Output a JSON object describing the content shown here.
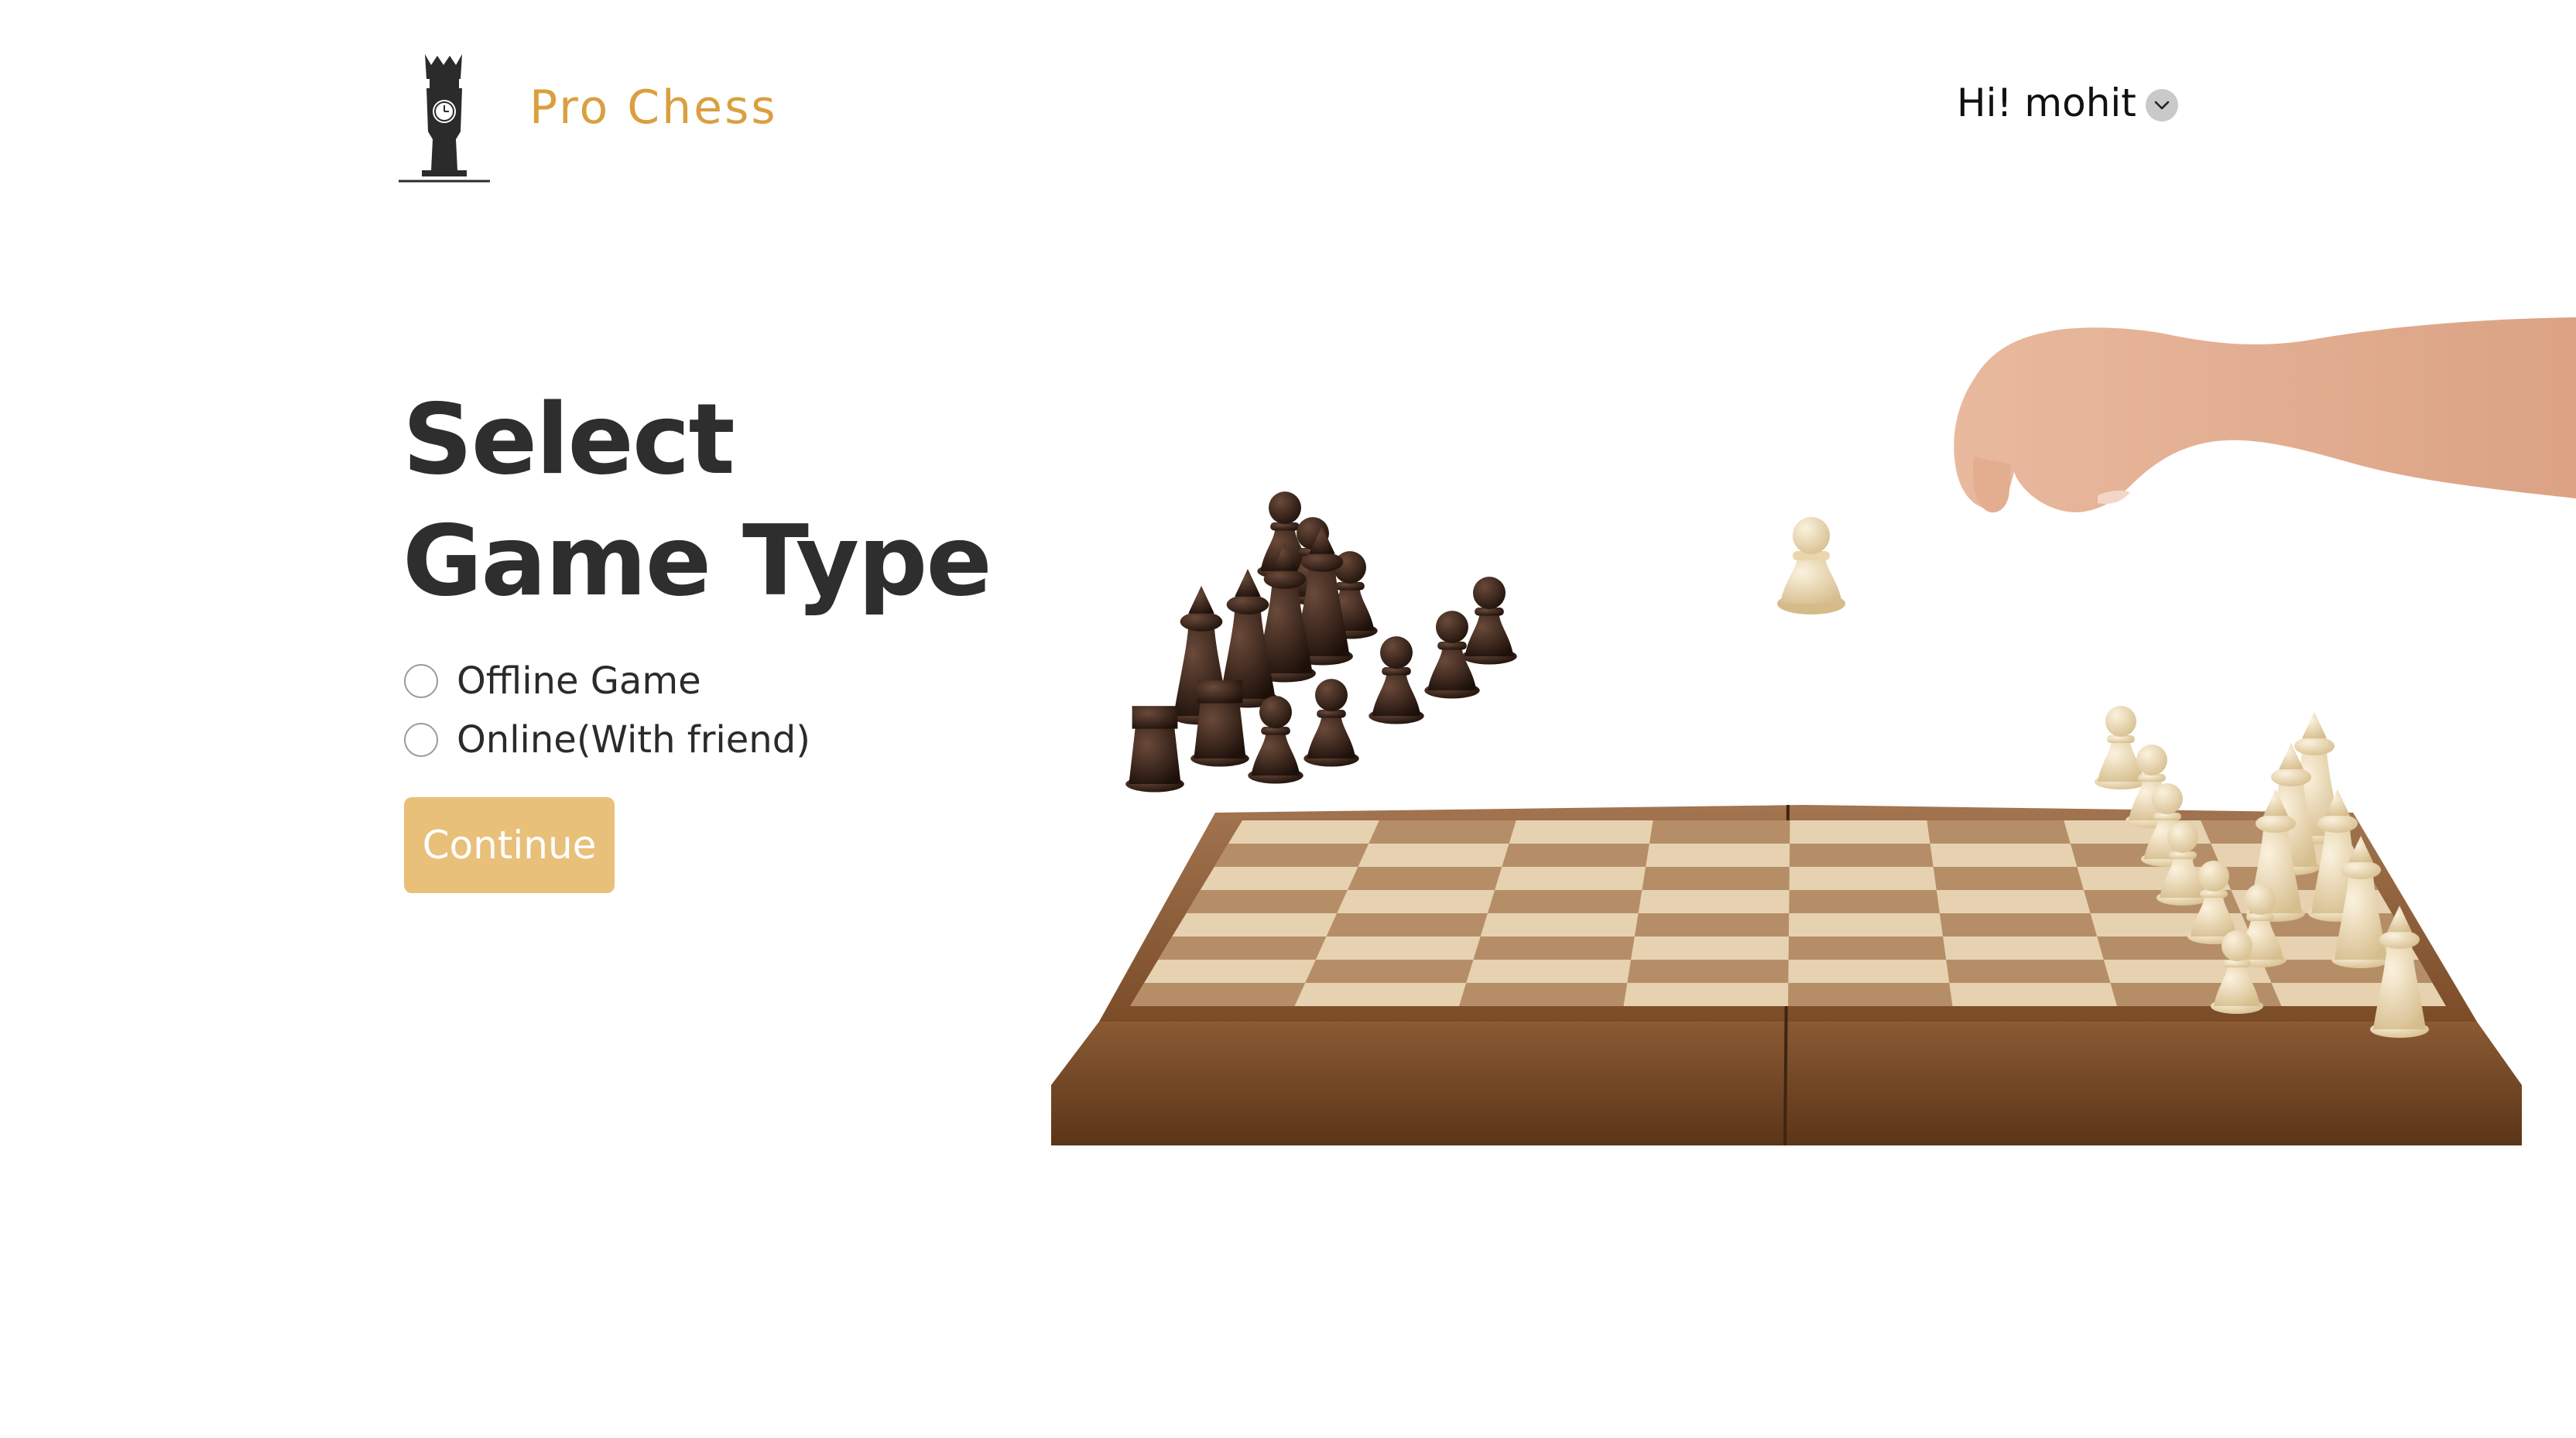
{
  "header": {
    "brand": "Pro Chess",
    "user_greeting": "Hi! mohit",
    "user_menu_icon": "chevron-down-icon",
    "logo_icon": "chess-queen-clock-icon"
  },
  "main": {
    "title_line1": "Select",
    "title_line2": "Game Type",
    "options": [
      {
        "label": "Offline Game",
        "selected": false
      },
      {
        "label": "Online(With friend)",
        "selected": false
      }
    ],
    "continue_label": "Continue"
  },
  "colors": {
    "brand": "#d9a03f",
    "button": "#e8c07a",
    "title": "#2e2e2e"
  }
}
